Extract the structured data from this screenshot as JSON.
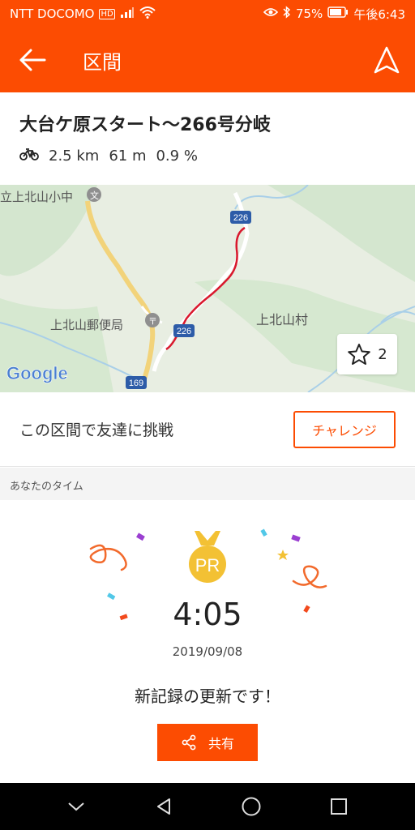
{
  "status": {
    "carrier": "NTT DOCOMO",
    "hd": "HD",
    "battery": "75%",
    "time": "午後6:43"
  },
  "appbar": {
    "title": "区間",
    "back_icon": "arrow-left-icon",
    "nav_icon": "navigation-icon"
  },
  "segment": {
    "name": "大台ケ原スタート〜266号分岐",
    "distance": "2.5 km",
    "elevation": "61 m",
    "grade": "0.9 %"
  },
  "map": {
    "labels": {
      "school": "立上北山小中",
      "post_office": "上北山郵便局",
      "village": "上北山村",
      "route_226_top": "226",
      "route_226_bottom": "226",
      "route_169": "169",
      "google": "Google"
    },
    "star_count": "2"
  },
  "challenge": {
    "text": "この区間で友達に挑戦",
    "button": "チャレンジ"
  },
  "your_time": {
    "section_label": "あなたのタイム",
    "badge": "PR",
    "time": "4:05",
    "date": "2019/09/08",
    "message": "新記録の更新です！",
    "share_label": "共有"
  },
  "colors": {
    "accent": "#fc4c02",
    "gold": "#f3c134",
    "route": "#d9182d"
  }
}
